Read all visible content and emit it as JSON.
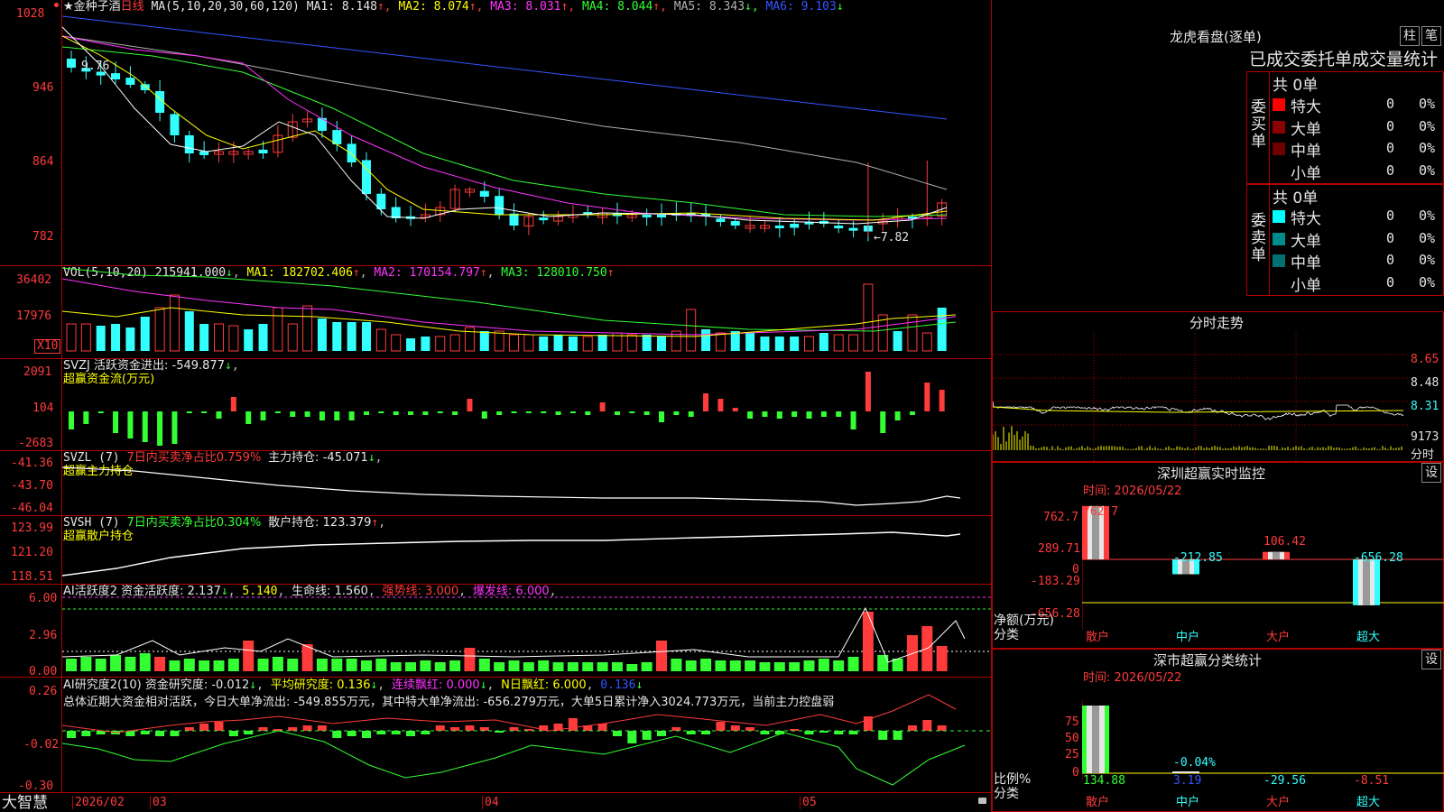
{
  "colors": {
    "up": "#ff3b3b",
    "down": "#33ffff",
    "ma1": "#ffffff",
    "ma2": "#ffff00",
    "ma3": "#ff33ff",
    "ma4": "#33ff33",
    "ma5": "#b0b0b0",
    "ma6": "#3355ff",
    "frame": "#b00000"
  },
  "price": {
    "stock": "★金种子酒",
    "period": "日线",
    "ma_label": "MA(5,10,20,30,60,120)",
    "ma": [
      {
        "name": "MA1:",
        "value": "8.148",
        "trend": "↑",
        "color": "white"
      },
      {
        "name": "MA2:",
        "value": "8.074",
        "trend": "↑",
        "color": "yel"
      },
      {
        "name": "MA3:",
        "value": "8.031",
        "trend": "↑",
        "color": "mag"
      },
      {
        "name": "MA4:",
        "value": "8.044",
        "trend": "↑",
        "color": "grn"
      },
      {
        "name": "MA5:",
        "value": "8.343",
        "trend": "↓",
        "color": "gry"
      },
      {
        "name": "MA6:",
        "value": "9.103",
        "trend": "↓",
        "color": "blu"
      }
    ],
    "axis": [
      "1028",
      "946",
      "864",
      "782"
    ],
    "high_note": "9.76",
    "low_note": "←7.82"
  },
  "vol": {
    "label": "VOL(5,10,20)",
    "value": "215941.000",
    "trend": "↓",
    "ma1": "MA1: 182702.406",
    "ma1_t": "↑",
    "ma2": "MA2: 170154.797",
    "ma2_t": "↑",
    "ma3": "MA3: 128010.750",
    "ma3_t": "↑",
    "axis": [
      "36402",
      "17976"
    ],
    "unit": "X10"
  },
  "svzj": {
    "label": "SVZJ  活跃资金进出: -549.877",
    "trend": "↓",
    "sub": "超赢资金流(万元)",
    "axis": [
      "2091",
      "104",
      "-2683"
    ]
  },
  "svzl": {
    "label": "SVZL (7)",
    "ratio": "7日内买卖净占比0.759%",
    "hold": "主力持仓: -45.071",
    "trend": "↓",
    "sub": "超赢主力持仓",
    "axis": [
      "-41.36",
      "-43.70",
      "-46.04"
    ]
  },
  "svsh": {
    "label": "SVSH (7)",
    "ratio": "7日内买卖净占比0.304%",
    "hold": "散户持仓: 123.379",
    "trend": "↑",
    "sub": "超赢散户持仓",
    "axis": [
      "123.99",
      "121.20",
      "118.51"
    ]
  },
  "ai1": {
    "label": "AI活跃度2 资金活跃度: 2.137",
    "t1": "↓",
    "v2": "5.140",
    "life": "生命线: 1.560",
    "strong": "强势线: 3.000",
    "burst": "爆发线: 6.000",
    "axis": [
      "6.00",
      "2.96",
      "0.00"
    ]
  },
  "ai2": {
    "label": "AI研究度2(10) 资金研究度: -0.012",
    "t1": "↓",
    "avg": "平均研究度: 0.136",
    "t2": "↓",
    "red": "连续飘红: 0.000",
    "t3": "↓",
    "n": "N日飘红: 6.000",
    "v5": "0.136",
    "t5": "↓",
    "summary": "总体近期大资金相对活跃，今日大单净流出: -549.855万元，其中特大单净流出: -656.279万元，大单5日累计净入3024.773万元，当前主力控盘弱",
    "axis": [
      "0.26",
      "-0.02",
      "-0.30"
    ]
  },
  "dates": {
    "brand": "大智慧",
    "d1": "2026/02",
    "d2": "03",
    "d3": "04",
    "d4": "05"
  },
  "longhu": {
    "title": "龙虎看盘(逐单)",
    "btn1": "柱",
    "btn2": "笔",
    "tab": "已成交委托单成交量统计",
    "buy_label": "委买单",
    "sell_label": "委卖单",
    "buy": {
      "total": "共 0单",
      "rows": [
        {
          "name": "特大",
          "n": "0",
          "p": "0%",
          "c": "#ff0000"
        },
        {
          "name": "大单",
          "n": "0",
          "p": "0%",
          "c": "#8b0000"
        },
        {
          "name": "中单",
          "n": "0",
          "p": "0%",
          "c": "#700000"
        },
        {
          "name": "小单",
          "n": "0",
          "p": "0%",
          "c": "#000000"
        }
      ]
    },
    "sell": {
      "total": "共 0单",
      "rows": [
        {
          "name": "特大",
          "n": "0",
          "p": "0%",
          "c": "#00ffff"
        },
        {
          "name": "大单",
          "n": "0",
          "p": "0%",
          "c": "#008b8b"
        },
        {
          "name": "中单",
          "n": "0",
          "p": "0%",
          "c": "#007070"
        },
        {
          "name": "小单",
          "n": "0",
          "p": "0%",
          "c": "#000000"
        }
      ]
    }
  },
  "fenshi": {
    "title": "分时走势",
    "axis": [
      "8.65",
      "8.48",
      "8.31"
    ],
    "vol": "9173",
    "vol_unit": "分时"
  },
  "monitor": {
    "title": "深圳超赢实时监控",
    "btn": "设",
    "time": "时间: 2026/05/22",
    "axis": [
      "762.7",
      "289.71",
      "0",
      "-183.29",
      "-656.28"
    ],
    "ylabel": "净额(万元)",
    "xlabel": "分类",
    "items": [
      {
        "cat": "散户",
        "value": "762.7",
        "v": 762.7
      },
      {
        "cat": "中户",
        "value": "-212.85",
        "v": -212.85
      },
      {
        "cat": "大户",
        "value": "106.42",
        "v": 106.42
      },
      {
        "cat": "超大",
        "value": "-656.28",
        "v": -656.28
      }
    ]
  },
  "classify": {
    "title": "深市超赢分类统计",
    "btn": "设",
    "time": "时间: 2026/05/22",
    "axis": [
      "75",
      "50",
      "25",
      "0"
    ],
    "ylabel": "比例%",
    "xlabel": "分类",
    "top": "-0.04%",
    "items": [
      {
        "cat": "散户",
        "value": "134.88",
        "v": 134.88
      },
      {
        "cat": "中户",
        "value": "3.19",
        "v": 3.19
      },
      {
        "cat": "大户",
        "value": "-29.56",
        "v": -29.56
      },
      {
        "cat": "超大",
        "value": "-8.51",
        "v": -8.51
      }
    ]
  }
}
